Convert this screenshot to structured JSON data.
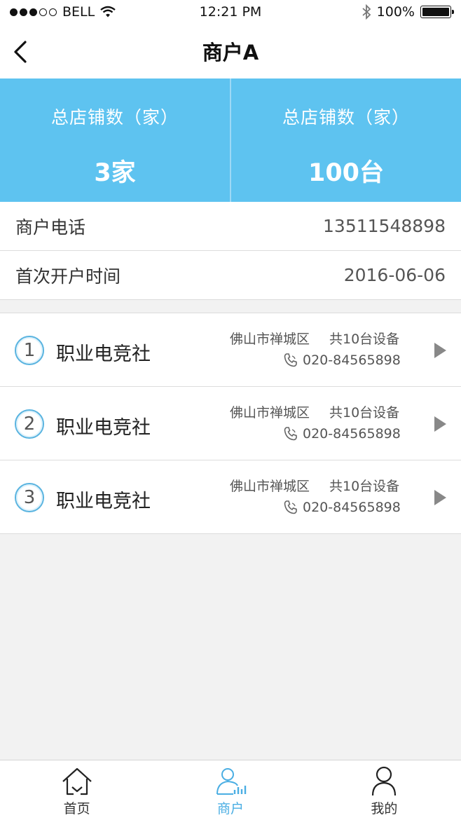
{
  "status_bar": {
    "carrier": "BELL",
    "time": "12:21 PM",
    "battery": "100%"
  },
  "nav": {
    "title": "商户A",
    "back_icon": "chevron-left-icon"
  },
  "stats": [
    {
      "label": "总店铺数（家）",
      "value": "3家"
    },
    {
      "label": "总店铺数（家）",
      "value": "100台"
    }
  ],
  "info": {
    "phone_label": "商户电话",
    "phone_value": "13511548898",
    "opened_label": "首次开户时间",
    "opened_value": "2016-06-06"
  },
  "stores": [
    {
      "index": "1",
      "name": "职业电竞社",
      "address": "佛山市禅城区",
      "devices": "共10台设备",
      "phone": "020-84565898"
    },
    {
      "index": "2",
      "name": "职业电竞社",
      "address": "佛山市禅城区",
      "devices": "共10台设备",
      "phone": "020-84565898"
    },
    {
      "index": "3",
      "name": "职业电竞社",
      "address": "佛山市禅城区",
      "devices": "共10台设备",
      "phone": "020-84565898"
    }
  ],
  "tabs": [
    {
      "label": "首页",
      "icon": "home-icon"
    },
    {
      "label": "商户",
      "icon": "merchant-icon",
      "active": true
    },
    {
      "label": "我的",
      "icon": "profile-icon"
    }
  ],
  "colors": {
    "accent": "#5ec3f0",
    "tab_active": "#4aaee3"
  }
}
